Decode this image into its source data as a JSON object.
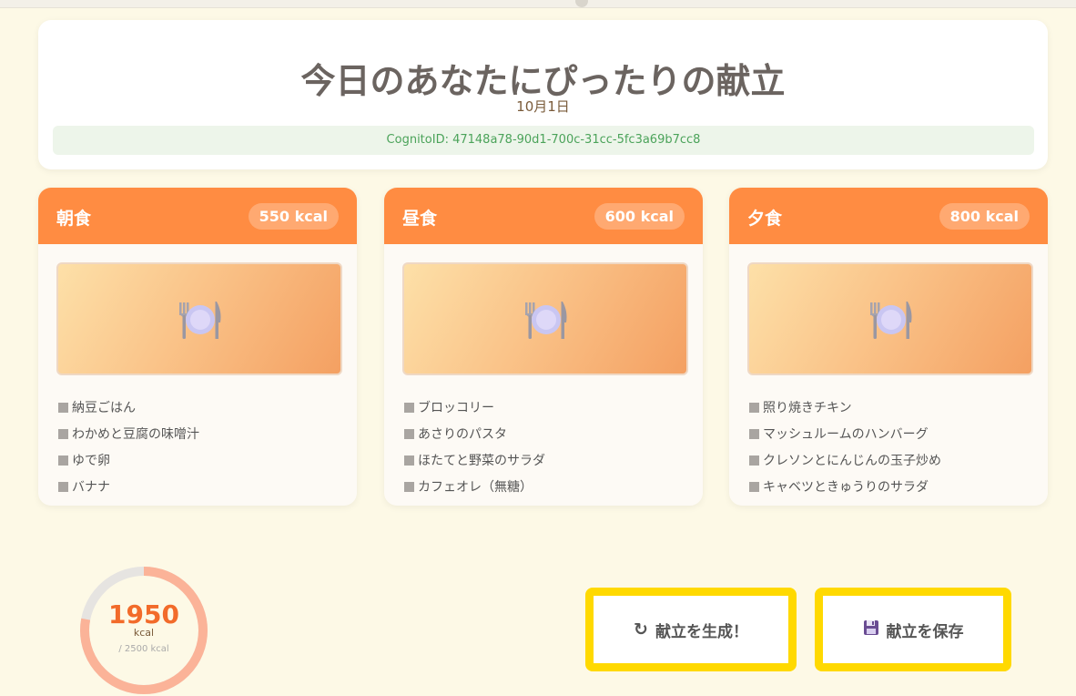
{
  "header": {
    "title": "今日のあなたにぴったりの献立",
    "date": "10月1日",
    "cognito_id": "CognitoID: 47148a78-90d1-700c-31cc-5fc3a69b7cc8"
  },
  "meals": [
    {
      "name": "朝食",
      "kcal": "550 kcal",
      "image_icon": "plate-with-cutlery-icon",
      "items": [
        "納豆ごはん",
        "わかめと豆腐の味噌汁",
        "ゆで卵",
        "バナナ"
      ]
    },
    {
      "name": "昼食",
      "kcal": "600 kcal",
      "image_icon": "plate-with-cutlery-icon",
      "items": [
        "ブロッコリー",
        "あさりのパスタ",
        "ほたてと野菜のサラダ",
        "カフェオレ（無糖）"
      ]
    },
    {
      "name": "夕食",
      "kcal": "800 kcal",
      "image_icon": "plate-with-cutlery-icon",
      "items": [
        "照り焼きチキン",
        "マッシュルームのハンバーグ",
        "クレソンとにんじんの玉子炒め",
        "キャベツときゅうりのサラダ"
      ]
    }
  ],
  "summary": {
    "total": "1950",
    "unit": "kcal",
    "max_label": "/ 2500 kcal",
    "progress": 0.78
  },
  "actions": {
    "generate_label": "献立を生成！",
    "generate_icon": "refresh-icon",
    "save_label": "献立を保存",
    "save_icon": "floppy-disk-icon"
  },
  "colors": {
    "accent": "#ff8c42",
    "button_border": "#ffd900",
    "background": "#fdf9e6",
    "id_text": "#4ba35a"
  }
}
